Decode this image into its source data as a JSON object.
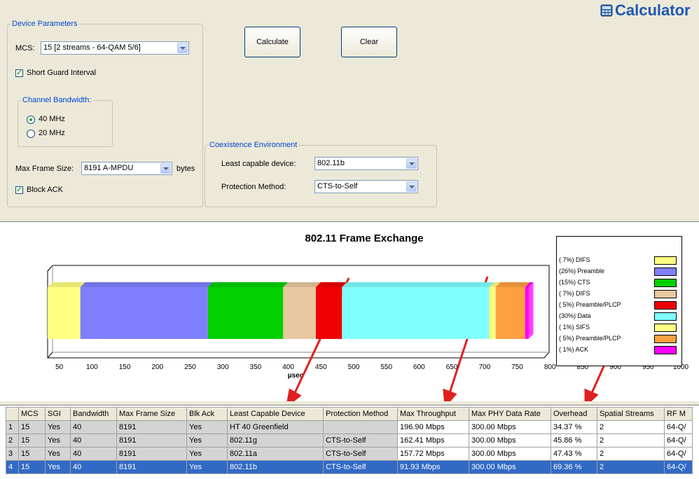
{
  "app": {
    "title": "Calculator"
  },
  "device_params": {
    "legend": "Device Parameters",
    "mcs_label": "MCS:",
    "mcs_value": "15 [2 streams - 64-QAM 5/6]",
    "sgi_label": "Short Guard Interval",
    "sgi_checked": true,
    "bandwidth_legend": "Channel Bandwidth:",
    "bw_40": "40 MHz",
    "bw_20": "20 MHz",
    "bw_selected": "40 MHz",
    "max_frame_label": "Max Frame Size:",
    "max_frame_value": "8191  A-MPDU",
    "bytes_label": "bytes",
    "block_ack_label": "Block ACK",
    "block_ack_checked": true
  },
  "buttons": {
    "calculate": "Calculate",
    "clear": "Clear"
  },
  "coexistence": {
    "legend": "Coexistence Environment",
    "least_label": "Least capable device:",
    "least_value": "802.11b",
    "protection_label": "Protection Method:",
    "protection_value": "CTS-to-Self"
  },
  "chart_data": {
    "type": "bar",
    "title": "802.11 Frame Exchange",
    "xlabel": "µsec",
    "xticks": [
      "50",
      "100",
      "150",
      "200",
      "250",
      "300",
      "350",
      "400",
      "450",
      "500",
      "550",
      "600",
      "650",
      "700",
      "750",
      "800",
      "850",
      "900",
      "950",
      "1000"
    ],
    "segments": [
      {
        "name": "DIFS",
        "pct": "( 7%)",
        "start": 0,
        "end": 50,
        "color": "#ffff80"
      },
      {
        "name": "Preamble",
        "pct": "(26%)",
        "start": 50,
        "end": 245,
        "color": "#8080ff"
      },
      {
        "name": "CTS",
        "pct": "(15%)",
        "start": 245,
        "end": 360,
        "color": "#00d000"
      },
      {
        "name": "DIFS",
        "pct": "( 7%)",
        "start": 360,
        "end": 410,
        "color": "#e8c8a0"
      },
      {
        "name": "Preamble/PLCP",
        "pct": "( 5%)",
        "start": 410,
        "end": 450,
        "color": "#f00000"
      },
      {
        "name": "Data",
        "pct": "(30%)",
        "start": 450,
        "end": 675,
        "color": "#80ffff"
      },
      {
        "name": "SIFS",
        "pct": "( 1%)",
        "start": 675,
        "end": 685,
        "color": "#ffff80"
      },
      {
        "name": "Preamble/PLCP",
        "pct": "( 5%)",
        "start": 685,
        "end": 730,
        "color": "#ffa040"
      },
      {
        "name": "ACK",
        "pct": "( 1%)",
        "start": 730,
        "end": 735,
        "color": "#ff00ff"
      }
    ],
    "legend_placement": "right"
  },
  "table": {
    "columns": [
      "MCS",
      "SGI",
      "Bandwidth",
      "Max Frame Size",
      "Blk Ack",
      "Least Capable Device",
      "Protection Method",
      "Max Throughput",
      "Max PHY Data Rate",
      "Overhead",
      "Spatial Streams",
      "RF M"
    ],
    "rows": [
      {
        "num": "1",
        "cells": [
          "15",
          "Yes",
          "40",
          "8191",
          "Yes",
          "HT 40 Greenfield",
          "",
          "196.90 Mbps",
          "300.00 Mbps",
          "34.37 %",
          "2",
          "64-Q/"
        ]
      },
      {
        "num": "2",
        "cells": [
          "15",
          "Yes",
          "40",
          "8191",
          "Yes",
          "802.11g",
          "CTS-to-Self",
          "162.41 Mbps",
          "300.00 Mbps",
          "45.86 %",
          "2",
          "64-Q/"
        ]
      },
      {
        "num": "3",
        "cells": [
          "15",
          "Yes",
          "40",
          "8191",
          "Yes",
          "802.11a",
          "CTS-to-Self",
          "157.72 Mbps",
          "300.00 Mbps",
          "47.43 %",
          "2",
          "64-Q/"
        ]
      },
      {
        "num": "4",
        "cells": [
          "15",
          "Yes",
          "40",
          "8191",
          "Yes",
          "802.11b",
          "CTS-to-Self",
          "91.93 Mbps",
          "300.00 Mbps",
          "69.36 %",
          "2",
          "64-Q/"
        ]
      }
    ],
    "selected_row": "4"
  },
  "annotations": {
    "arrow_color": "#e02020"
  }
}
